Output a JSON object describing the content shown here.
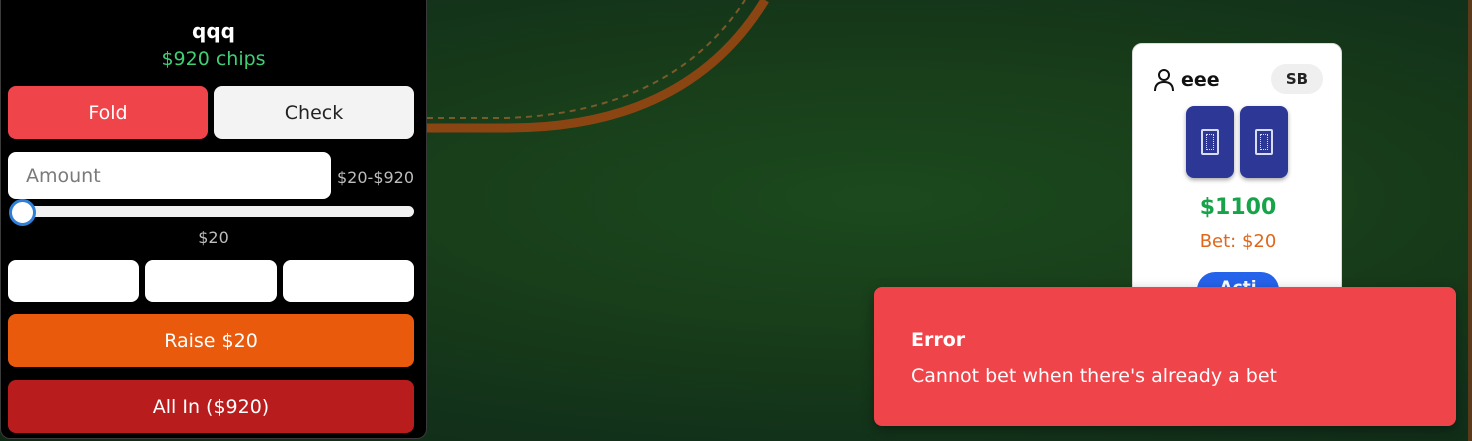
{
  "player": {
    "name": "qqq",
    "chips": "$920 chips"
  },
  "actions": {
    "fold_label": "Fold",
    "check_label": "Check",
    "amount_placeholder": "Amount",
    "range_label": "$20-$920",
    "slider_value": "$20",
    "slider_min": 20,
    "slider_max": 920,
    "slider_current": 20,
    "presets": [
      "",
      "",
      ""
    ],
    "raise_label": "Raise $20",
    "allin_label": "All In ($920)"
  },
  "opponent": {
    "name": "eee",
    "position_badge": "SB",
    "stack": "$1100",
    "bet": "Bet: $20",
    "status": "Acti",
    "card_back_color": "#2d3796"
  },
  "toast": {
    "title": "Error",
    "message": "Cannot bet when there's already a bet"
  },
  "colors": {
    "felt": "#173b19",
    "rail": "#8b4513",
    "fold": "#ef444a",
    "raise": "#ea5a0c",
    "all_in": "#b91c1c",
    "chips_text": "#3fcf75",
    "toast_bg": "#ef444a",
    "status": "#2563eb"
  }
}
